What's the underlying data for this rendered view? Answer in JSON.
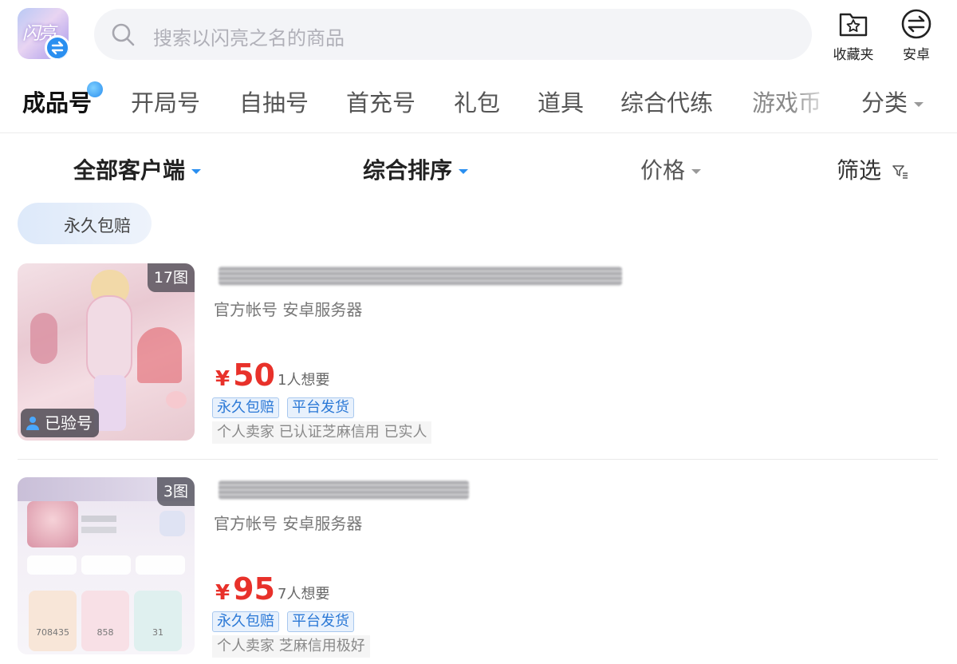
{
  "header": {
    "logo_text": "闪亮",
    "search_placeholder": "搜索以闪亮之名的商品",
    "favorites_label": "收藏夹",
    "platform_label": "安卓"
  },
  "tabs": [
    {
      "label": "成品号",
      "active": true
    },
    {
      "label": "开局号"
    },
    {
      "label": "自抽号"
    },
    {
      "label": "首充号"
    },
    {
      "label": "礼包"
    },
    {
      "label": "道具"
    },
    {
      "label": "综合代练"
    },
    {
      "label": "游戏币"
    }
  ],
  "tab_more": "分类",
  "filters": {
    "client": "全部客户端",
    "sort": "综合排序",
    "price": "价格",
    "screen": "筛选"
  },
  "chip": "永久包赔",
  "listings": [
    {
      "image_count": "17图",
      "verified": "已验号",
      "meta": "官方帐号 安卓服务器",
      "currency": "¥",
      "price": "50",
      "wants": "1人想要",
      "tags": [
        "永久包赔",
        "平台发货"
      ],
      "seller": "个人卖家  已认证芝麻信用  已实人"
    },
    {
      "image_count": "3图",
      "meta": "官方帐号 安卓服务器",
      "currency": "¥",
      "price": "95",
      "wants": "7人想要",
      "tags": [
        "永久包赔",
        "平台发货"
      ],
      "seller": "个人卖家  芝麻信用极好",
      "thumb_stats": [
        "708435",
        "858",
        "31"
      ]
    }
  ],
  "colors": {
    "accent": "#2a8ff0",
    "price": "#e8312a",
    "tag_text": "#2a78d6"
  }
}
